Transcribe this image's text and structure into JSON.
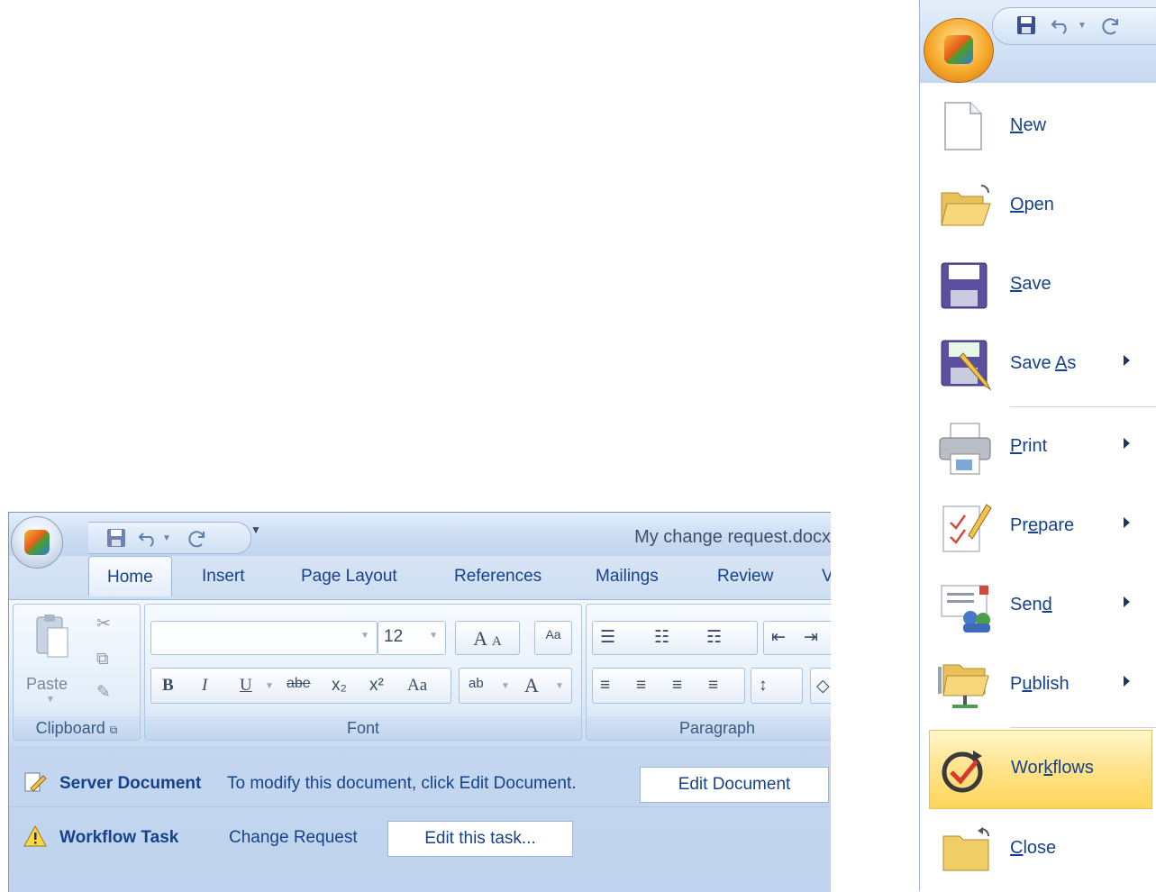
{
  "word": {
    "title": "My change request.docx",
    "tabs": [
      "Home",
      "Insert",
      "Page Layout",
      "References",
      "Mailings",
      "Review",
      "V"
    ],
    "active_tab": "Home",
    "clipboard": {
      "paste_label": "Paste",
      "group_label": "Clipboard"
    },
    "font": {
      "font_name": "",
      "font_size": "12",
      "group_label": "Font",
      "bold": "B",
      "italic": "I",
      "underline": "U",
      "strike": "abe",
      "sub": "x₂",
      "sup": "x²",
      "case": "Aa",
      "grow": "A",
      "shrink": "A",
      "color": "A",
      "highlight": "ab"
    },
    "paragraph": {
      "group_label": "Paragraph"
    },
    "infobar": {
      "server_title": "Server Document",
      "server_msg": "To modify this document, click Edit Document.",
      "server_btn": "Edit Document",
      "workflow_title": "Workflow Task",
      "workflow_msg": "Change Request",
      "workflow_btn": "Edit this task..."
    }
  },
  "menu": {
    "items": [
      {
        "pre": "",
        "key": "N",
        "post": "ew",
        "submenu": false
      },
      {
        "pre": "",
        "key": "O",
        "post": "pen",
        "submenu": false
      },
      {
        "pre": "",
        "key": "S",
        "post": "ave",
        "submenu": false
      },
      {
        "pre": "Save ",
        "key": "A",
        "post": "s",
        "submenu": true
      },
      {
        "pre": "",
        "key": "P",
        "post": "rint",
        "submenu": true
      },
      {
        "pre": "Pr",
        "key": "e",
        "post": "pare",
        "submenu": true
      },
      {
        "pre": "Sen",
        "key": "d",
        "post": "",
        "submenu": true
      },
      {
        "pre": "P",
        "key": "u",
        "post": "blish",
        "submenu": true
      },
      {
        "pre": "Wor",
        "key": "k",
        "post": "flows",
        "submenu": false,
        "highlighted": true
      },
      {
        "pre": "",
        "key": "C",
        "post": "lose",
        "submenu": false
      }
    ]
  },
  "colors": {
    "accent": "#15428b",
    "highlight": "#ffd65a",
    "ribbon": "#dfeaf8"
  }
}
